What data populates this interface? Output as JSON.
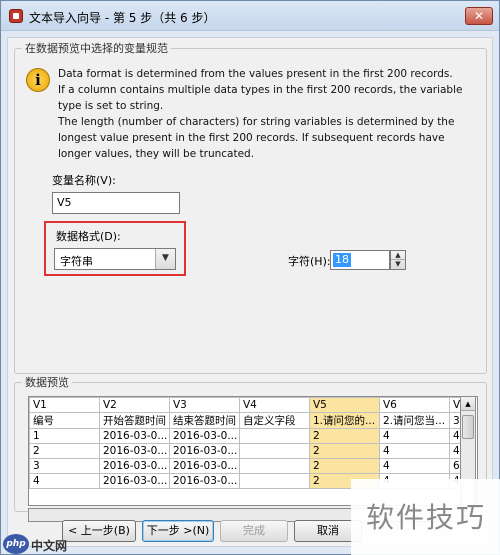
{
  "window": {
    "title": "文本导入向导 - 第 5 步（共 6 步）",
    "close_glyph": "✕"
  },
  "spec_group": {
    "legend": "在数据预览中选择的变量规范",
    "info_lines": [
      "Data format is determined from the values present in the first 200 records.",
      "If a column contains multiple data types in the first 200 records, the variable type is set to string.",
      "The length (number of characters) for string variables is determined by the longest value present in the first 200 records. If subsequent records have longer values, they will be truncated."
    ],
    "varname_label": "变量名称(V):",
    "varname_value": "V5",
    "format_label": "数据格式(D):",
    "format_value": "字符串",
    "width_label": "字符(H):",
    "width_value": "18"
  },
  "preview": {
    "legend": "数据预览",
    "columns": [
      "V1",
      "V2",
      "V3",
      "V4",
      "V5",
      "V6",
      "V"
    ],
    "selected_column": 4,
    "rows": [
      [
        "编号",
        "开始答题时间",
        "结束答题时间",
        "自定义字段",
        "1.请问您的...",
        "2.请问您当...",
        "3"
      ],
      [
        "1",
        "2016-03-0...",
        "2016-03-0...",
        "",
        "2",
        "4",
        "4"
      ],
      [
        "2",
        "2016-03-0...",
        "2016-03-0...",
        "",
        "2",
        "4",
        "4"
      ],
      [
        "3",
        "2016-03-0...",
        "2016-03-0...",
        "",
        "2",
        "4",
        "6"
      ],
      [
        "4",
        "2016-03-0...",
        "2016-03-0...",
        "",
        "2",
        "4",
        "4"
      ]
    ]
  },
  "buttons": {
    "back": "< 上一步(B)",
    "next": "下一步 >(N)",
    "finish": "完成",
    "cancel": "取消"
  },
  "watermark": {
    "left_logo": "php",
    "left_text": "中文网",
    "right_text": "软件技巧"
  }
}
